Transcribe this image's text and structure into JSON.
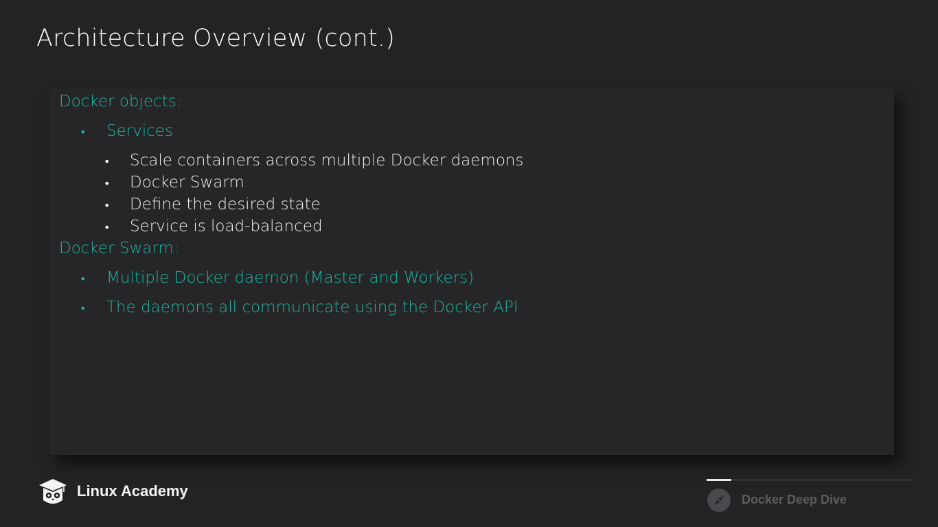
{
  "slide": {
    "title": "Architecture Overview (cont.)"
  },
  "content": {
    "sections": [
      {
        "heading": "Docker objects:",
        "items": [
          {
            "label": "Services",
            "subitems": [
              "Scale containers across multiple Docker daemons",
              "Docker Swarm",
              "Define the desired state",
              "Service is load-balanced"
            ]
          }
        ]
      },
      {
        "heading": "Docker Swarm:",
        "items": [
          {
            "label": "Multiple Docker daemon (Master and Workers)"
          },
          {
            "label": "The daemons all communicate using the Docker API"
          }
        ]
      }
    ],
    "bullet_char": "•"
  },
  "footer": {
    "brand": "Linux Academy",
    "course": "Docker Deep Dive",
    "progress_fraction": 0.12
  },
  "colors": {
    "background": "#232225",
    "panel": "#262628",
    "accent": "#1fb5a3",
    "text": "#f2f2f2",
    "muted": "#5d5d61"
  },
  "icons": {
    "brand_logo": "owl-graduation-cap-icon",
    "course_icon": "compass-icon"
  }
}
